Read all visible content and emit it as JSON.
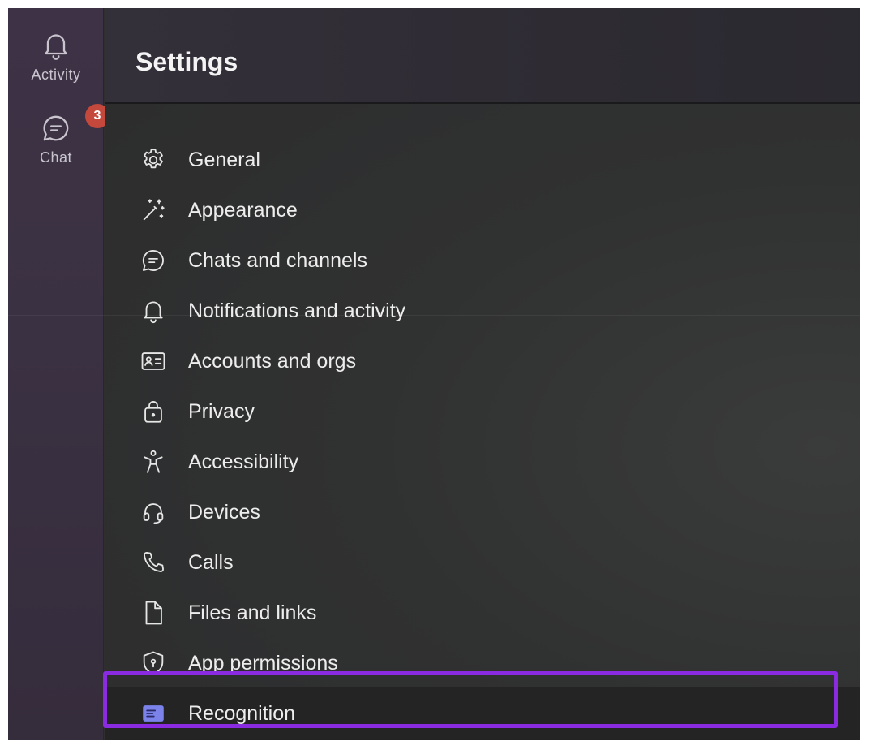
{
  "rail": {
    "items": [
      {
        "label": "Activity",
        "icon": "bell-icon"
      },
      {
        "label": "Chat",
        "icon": "chat-icon",
        "badge": "3"
      }
    ]
  },
  "settings": {
    "title": "Settings",
    "items": [
      {
        "label": "General",
        "icon": "gear-icon"
      },
      {
        "label": "Appearance",
        "icon": "magic-wand-icon"
      },
      {
        "label": "Chats and channels",
        "icon": "chat-bubble-icon"
      },
      {
        "label": "Notifications and activity",
        "icon": "bell-icon"
      },
      {
        "label": "Accounts and orgs",
        "icon": "id-card-icon"
      },
      {
        "label": "Privacy",
        "icon": "lock-icon"
      },
      {
        "label": "Accessibility",
        "icon": "accessibility-icon"
      },
      {
        "label": "Devices",
        "icon": "headset-icon"
      },
      {
        "label": "Calls",
        "icon": "phone-icon"
      },
      {
        "label": "Files and links",
        "icon": "file-icon"
      },
      {
        "label": "App permissions",
        "icon": "shield-icon"
      },
      {
        "label": "Recognition",
        "icon": "recognition-icon",
        "selected": true
      }
    ]
  },
  "colors": {
    "highlight_border": "#8a2be2",
    "badge": "#c4483b",
    "recognition_icon": "#7b83eb"
  }
}
